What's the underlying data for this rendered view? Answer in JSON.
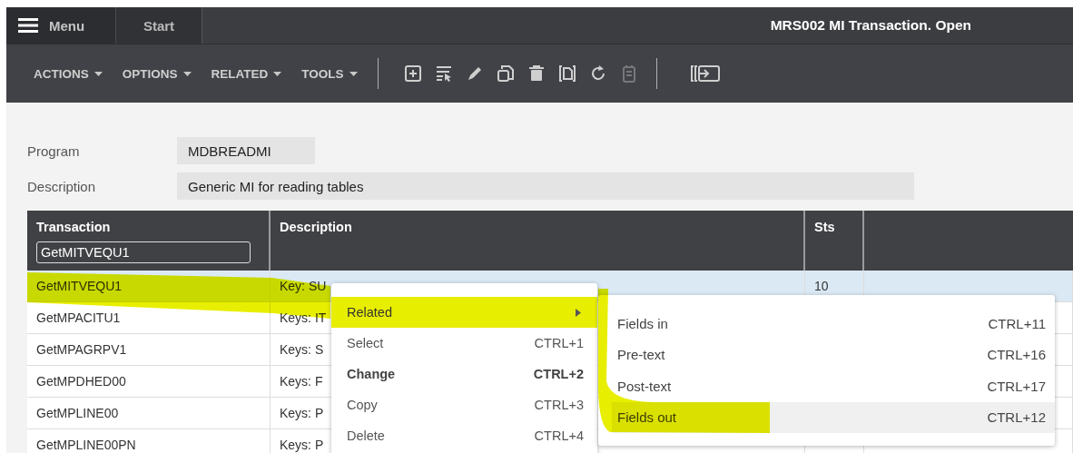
{
  "top_bar": {
    "menu_label": "Menu",
    "tabs": [
      {
        "label": "Start",
        "selected": false
      }
    ],
    "title": "MRS002 MI Transaction. Open"
  },
  "toolbar": {
    "menus": [
      "ACTIONS",
      "OPTIONS",
      "RELATED",
      "TOOLS"
    ],
    "icons": [
      {
        "kind": "add",
        "disabled": false
      },
      {
        "kind": "select",
        "disabled": false
      },
      {
        "kind": "edit",
        "disabled": false
      },
      {
        "kind": "copy",
        "disabled": false
      },
      {
        "kind": "delete",
        "disabled": false
      },
      {
        "kind": "display",
        "disabled": false
      },
      {
        "kind": "refresh",
        "disabled": false
      },
      {
        "kind": "notes",
        "disabled": true
      },
      {
        "kind": "exit",
        "disabled": false
      }
    ]
  },
  "form": [
    {
      "label": "Program",
      "value": "MDBREADMI",
      "kind": "short"
    },
    {
      "label": "Description",
      "value": "Generic MI for reading tables",
      "kind": "long"
    }
  ],
  "table": {
    "columns": [
      "Transaction",
      "Description",
      "Sts"
    ],
    "filter": "GetMITVEQU1",
    "rows": [
      {
        "transaction": "GetMITVEQU1",
        "description": "Key: SU",
        "sts": "10",
        "selected": true
      },
      {
        "transaction": "GetMPACITU1",
        "description": "Keys: IT",
        "selected": false
      },
      {
        "transaction": "GetMPAGRPV1",
        "description": "Keys: S",
        "selected": false
      },
      {
        "transaction": "GetMPDHED00",
        "description": "Keys: F",
        "selected": false
      },
      {
        "transaction": "GetMPLINE00",
        "description": "Keys: P",
        "selected": false
      },
      {
        "transaction": "GetMPLINE00PN",
        "description": "Keys: P",
        "selected": false
      }
    ]
  },
  "context_menu": {
    "items": [
      {
        "label": "Related",
        "submenu": true,
        "default": false,
        "selected": true
      },
      {
        "label": "Select",
        "shortcut": "CTRL+1",
        "submenu": false,
        "default": false,
        "selected": false
      },
      {
        "label": "Change",
        "shortcut": "CTRL+2",
        "submenu": false,
        "default": true,
        "selected": false
      },
      {
        "label": "Copy",
        "shortcut": "CTRL+3",
        "submenu": false,
        "default": false,
        "selected": false
      },
      {
        "label": "Delete",
        "shortcut": "CTRL+4",
        "submenu": false,
        "default": false,
        "selected": false
      }
    ],
    "submenu": [
      {
        "label": "Fields in",
        "shortcut": "CTRL+11",
        "selected": false
      },
      {
        "label": "Pre-text",
        "shortcut": "CTRL+16",
        "selected": false
      },
      {
        "label": "Post-text",
        "shortcut": "CTRL+17",
        "selected": false
      },
      {
        "label": "Fields out",
        "shortcut": "CTRL+12",
        "selected": true
      }
    ]
  }
}
